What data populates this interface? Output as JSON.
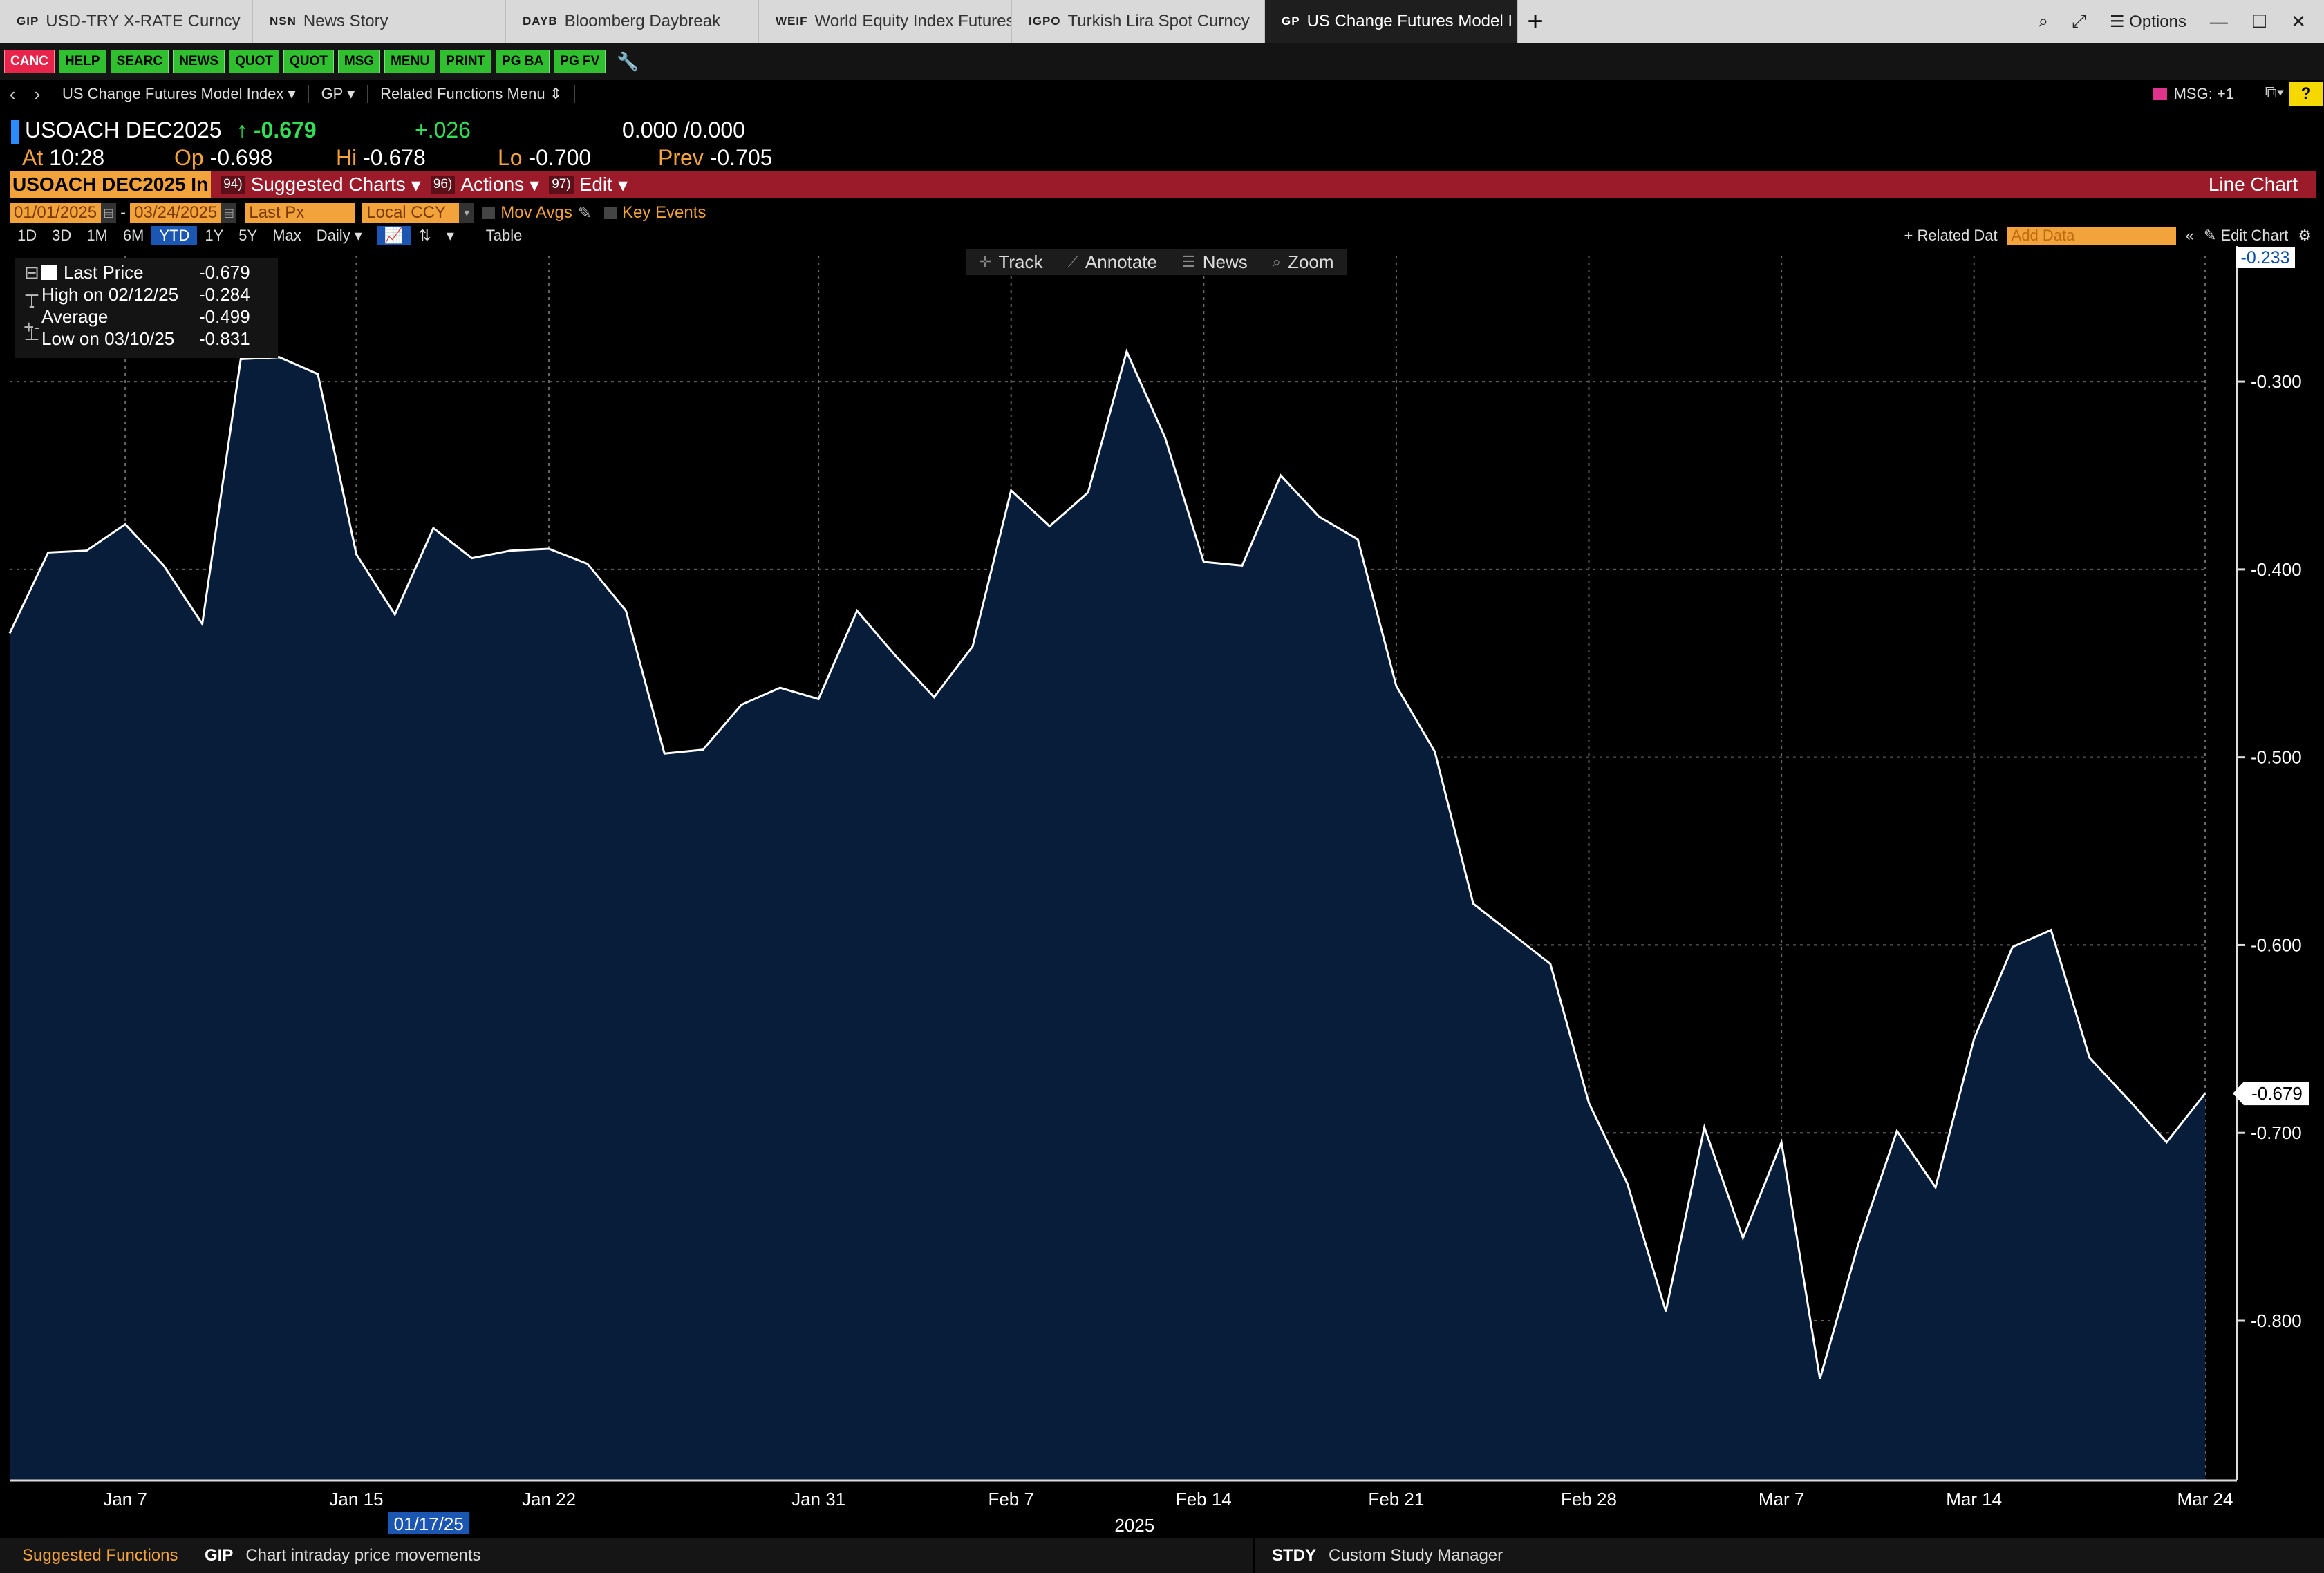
{
  "tabs": [
    {
      "code": "GIP",
      "label": "USD-TRY X-RATE Curncy"
    },
    {
      "code": "NSN",
      "label": "News Story"
    },
    {
      "code": "DAYB",
      "label": "Bloomberg Daybreak"
    },
    {
      "code": "WEIF",
      "label": "World Equity Index Futures"
    },
    {
      "code": "IGPO",
      "label": "Turkish Lira Spot Curncy"
    },
    {
      "code": "GP",
      "label": "US Change Futures Model I"
    }
  ],
  "window": {
    "options_label": "Options"
  },
  "fkeys": [
    "CANC",
    "HELP",
    "SEARC",
    "NEWS",
    "QUOT",
    "QUOT",
    "MSG",
    "MENU",
    "PRINT",
    "PG BA",
    "PG FV"
  ],
  "nav": {
    "security": "US Change Futures Model Index",
    "function": "GP",
    "related": "Related Functions Menu",
    "msg": "MSG: +1",
    "help": "?"
  },
  "quote": {
    "ticker": "USOACH DEC2025",
    "arrow": "↑",
    "last": "-0.679",
    "change": "+.026",
    "bid": "0.000",
    "ask": "0.000",
    "at_label": "At",
    "at": "10:28",
    "op_label": "Op",
    "op": "-0.698",
    "hi_label": "Hi",
    "hi": "-0.678",
    "lo_label": "Lo",
    "lo": "-0.700",
    "prev_label": "Prev",
    "prev": "-0.705"
  },
  "cmdbar": {
    "input": "USOACH DEC2025 In",
    "suggested_num": "94)",
    "suggested": "Suggested Charts",
    "actions_num": "96)",
    "actions": "Actions",
    "edit_num": "97)",
    "edit": "Edit",
    "chart_type": "Line Chart"
  },
  "controls": {
    "start_date": "01/01/2025",
    "end_date": "03/24/2025",
    "field": "Last Px",
    "currency": "Local CCY",
    "mov_avgs": "Mov Avgs",
    "key_events": "Key Events"
  },
  "periods": [
    "1D",
    "3D",
    "1M",
    "6M",
    "YTD",
    "1Y",
    "5Y",
    "Max"
  ],
  "active_period": "YTD",
  "frequency": "Daily",
  "table_label": "Table",
  "related_data": "+ Related Dat",
  "add_data_placeholder": "Add Data",
  "edit_chart": "Edit Chart",
  "toolbar": {
    "track": "Track",
    "annotate": "Annotate",
    "news": "News",
    "zoom": "Zoom"
  },
  "legend": [
    {
      "name": "Last Price",
      "value": "-0.679"
    },
    {
      "name": "High on 02/12/25",
      "value": "-0.284"
    },
    {
      "name": "Average",
      "value": "-0.499"
    },
    {
      "name": "Low on 03/10/25",
      "value": "-0.831"
    }
  ],
  "status": {
    "suggested": "Suggested Functions",
    "gip_code": "GIP",
    "gip_label": "Chart intraday price movements",
    "stdy_code": "STDY",
    "stdy_label": "Custom Study Manager"
  },
  "colors": {
    "line": "#ffffff",
    "fill": "#071d3a",
    "accent_orange": "#f3a33b",
    "up_green": "#33dd55",
    "cmdbar_red": "#9b1b2b"
  },
  "chart_data": {
    "type": "area",
    "y_ticks": [
      -0.3,
      -0.4,
      -0.5,
      -0.6,
      -0.7,
      -0.8
    ],
    "ylim": [
      -0.885,
      -0.233
    ],
    "x_ticks": [
      "Jan 7",
      "Jan 15",
      "Jan 22",
      "Jan 31",
      "Feb 7",
      "Feb 14",
      "Feb 21",
      "Feb 28",
      "Mar 7",
      "Mar 14",
      "Mar 24"
    ],
    "x_tick_index": [
      3,
      9,
      14,
      21,
      26,
      31,
      36,
      41,
      46,
      51,
      57
    ],
    "year_label": "2025",
    "highlight_date": "01/17/25",
    "max_label": "-0.233",
    "last_label": "-0.679",
    "grid": true,
    "values": [
      -0.434,
      -0.391,
      -0.39,
      -0.376,
      -0.398,
      -0.429,
      -0.288,
      -0.287,
      -0.296,
      -0.392,
      -0.424,
      -0.378,
      -0.394,
      -0.39,
      -0.389,
      -0.397,
      -0.422,
      -0.498,
      -0.496,
      -0.472,
      -0.463,
      -0.469,
      -0.422,
      -0.446,
      -0.468,
      -0.441,
      -0.358,
      -0.377,
      -0.359,
      -0.284,
      -0.33,
      -0.396,
      -0.398,
      -0.35,
      -0.372,
      -0.384,
      -0.462,
      -0.497,
      -0.578,
      -0.594,
      -0.61,
      -0.684,
      -0.727,
      -0.795,
      -0.697,
      -0.756,
      -0.705,
      -0.831,
      -0.759,
      -0.699,
      -0.729,
      -0.65,
      -0.601,
      -0.592,
      -0.66,
      -0.682,
      -0.705,
      -0.679
    ]
  }
}
